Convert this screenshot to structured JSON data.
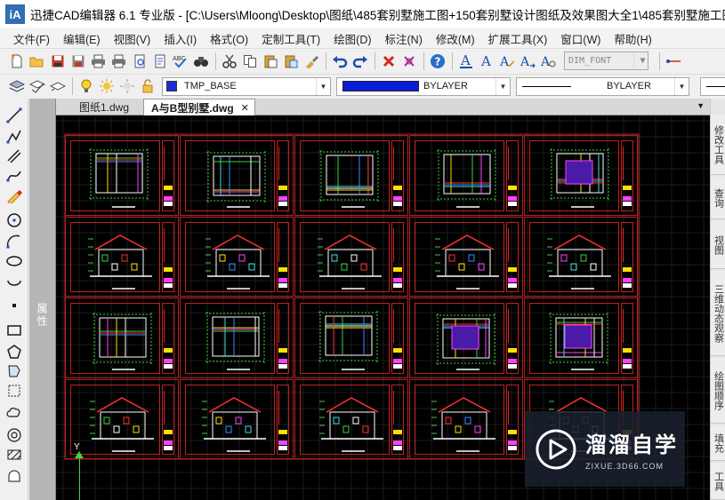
{
  "window": {
    "title": "迅捷CAD编辑器 6.1 专业版  - [C:\\Users\\Mloong\\Desktop\\图纸\\485套别墅施工图+150套别墅设计图纸及效果图大全1\\485套别墅施工图+150套别",
    "logo_text": "iA"
  },
  "menu": [
    "文件(F)",
    "编辑(E)",
    "视图(V)",
    "插入(I)",
    "格式(O)",
    "定制工具(T)",
    "绘图(D)",
    "标注(N)",
    "修改(M)",
    "扩展工具(X)",
    "窗口(W)",
    "帮助(H)"
  ],
  "toolbar": {
    "font_style": "DIM_FONT",
    "layer": "TMP_BASE",
    "color": "BYLAYER",
    "linetype": "BYLAYER"
  },
  "properties_panel": {
    "label": "属性"
  },
  "tabs": [
    {
      "label": "图纸1.dwg",
      "active": false
    },
    {
      "label": "A与B型别墅.dwg",
      "active": true
    }
  ],
  "tab_close": "✕",
  "ucs": {
    "y_label": "Y"
  },
  "right_tabs": [
    "修改工具",
    "查询",
    "视图",
    "三维动态观察",
    "绘图顺序",
    "填充",
    "工具"
  ],
  "watermark": {
    "title": "溜溜自学",
    "url": "ZIXUE.3D66.COM"
  },
  "icons": {
    "left_toolbar": [
      "line-icon",
      "polyline-icon",
      "multiline-icon",
      "spline-icon",
      "freehand-icon",
      "circle-icon",
      "arc-icon",
      "ellipse-icon",
      "ellipse-arc-icon",
      "point-icon",
      "rectangle-icon",
      "polygon-icon",
      "region-icon",
      "block-icon",
      "cloud-icon",
      "donut-icon",
      "hatch-icon",
      "wipeout-icon"
    ]
  },
  "colors": {
    "canvas": "#000000",
    "sheet_border": "#b02222",
    "layer_swatch": "#1b2ad4",
    "bylayer_swatch": "#0a1ed8",
    "ucs": "#3fd13f"
  }
}
